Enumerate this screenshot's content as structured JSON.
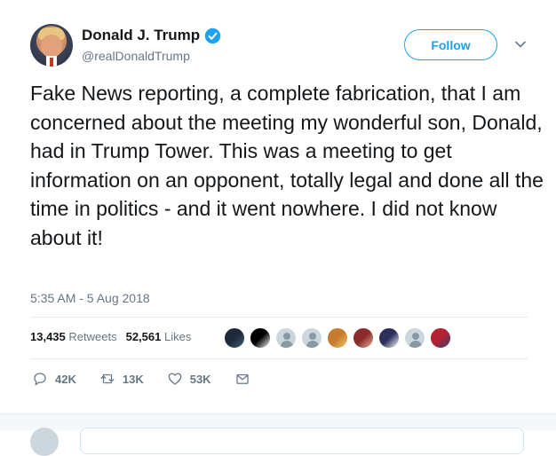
{
  "author": {
    "name": "Donald J. Trump",
    "handle": "@realDonaldTrump",
    "verified": true
  },
  "header": {
    "follow_label": "Follow",
    "menu_icon": "chevron-down-icon"
  },
  "tweet": {
    "text": "Fake News reporting, a complete fabrication, that I am concerned about the meeting my wonderful son, Donald, had in Trump Tower. This was a meeting to get information on an opponent, totally legal and done all the time in politics - and it went nowhere. I did not know about it!",
    "timestamp": "5:35 AM - 5 Aug 2018"
  },
  "stats": {
    "retweets_count": "13,435",
    "retweets_label": "Retweets",
    "likes_count": "52,561",
    "likes_label": "Likes"
  },
  "likers": [
    {
      "kind": "photo",
      "colors": [
        "#1e2a3a",
        "#3f5e7a"
      ]
    },
    {
      "kind": "photo",
      "colors": [
        "#000000",
        "#ffffff"
      ]
    },
    {
      "kind": "default"
    },
    {
      "kind": "default"
    },
    {
      "kind": "photo",
      "colors": [
        "#c77b2e",
        "#f2c46b"
      ]
    },
    {
      "kind": "photo",
      "colors": [
        "#8a2b2b",
        "#e6b39b"
      ]
    },
    {
      "kind": "photo",
      "colors": [
        "#2b2f5a",
        "#ffffff"
      ]
    },
    {
      "kind": "default"
    },
    {
      "kind": "photo",
      "colors": [
        "#b22234",
        "#3c3b6e"
      ]
    }
  ],
  "actions": {
    "reply_count": "42K",
    "retweet_count": "13K",
    "like_count": "53K"
  },
  "colors": {
    "accent": "#1da1f2",
    "secondary_text": "#657786",
    "divider": "#e6ecf0"
  }
}
